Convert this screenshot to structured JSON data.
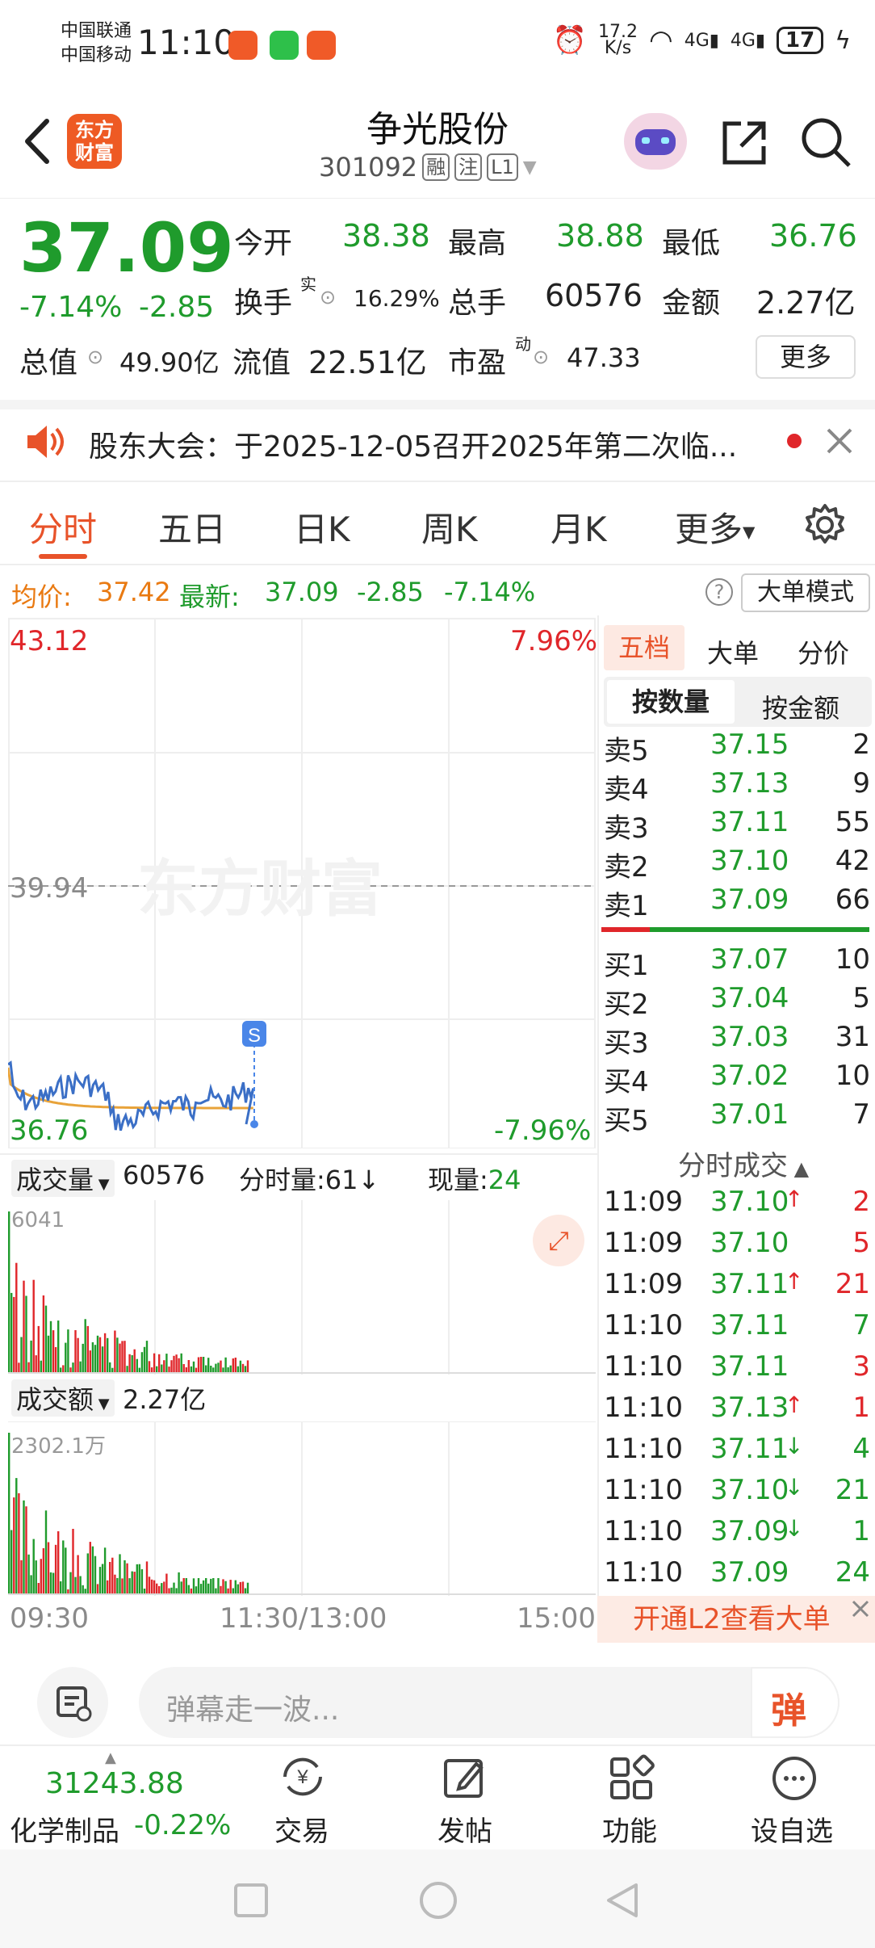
{
  "status": {
    "carrier1": "中国联通",
    "carrier2": "中国移动",
    "time": "11:10",
    "speed_top": "17.2",
    "speed_bot": "K/s",
    "net1": "4G",
    "net2": "4G",
    "battery": "17"
  },
  "header": {
    "logo_line1": "东方",
    "logo_line2": "财富",
    "name": "争光股份",
    "code": "301092",
    "tags": [
      "融",
      "注",
      "L1"
    ]
  },
  "quote": {
    "price": "37.09",
    "change_pct": "-7.14%",
    "change": "-2.85",
    "open_label": "今开",
    "open": "38.38",
    "high_label": "最高",
    "high": "38.88",
    "low_label": "最低",
    "low": "36.76",
    "turnover_label": "换手",
    "turnover_sup": "实",
    "turnover": "16.29%",
    "volume_label": "总手",
    "volume": "60576",
    "amount_label": "金额",
    "amount": "2.27亿",
    "mktcap_label": "总值",
    "mktcap": "49.90亿",
    "float_label": "流值",
    "float": "22.51亿",
    "pe_label": "市盈",
    "pe_sup": "动",
    "pe": "47.33",
    "more": "更多"
  },
  "notice": {
    "text": "股东大会：于2025-12-05召开2025年第二次临..."
  },
  "tabs": [
    "分时",
    "五日",
    "日K",
    "周K",
    "月K",
    "更多"
  ],
  "avg": {
    "avg_label": "均价:",
    "avg": "37.42",
    "latest_label": "最新:",
    "latest": "37.09",
    "chg": "-2.85",
    "pct": "-7.14%",
    "mode_btn": "大单模式"
  },
  "chart": {
    "top_price": "43.12",
    "top_pct": "7.96%",
    "mid_price": "39.94",
    "bot_price": "36.76",
    "bot_pct": "-7.96%",
    "watermark": "东方财富",
    "s_marker": "S",
    "vol_label": "成交量",
    "vol_value": "60576",
    "vol_min_label": "分时量:61",
    "vol_now_label": "现量:",
    "vol_now": "24",
    "vol_max": "6041",
    "amt_label": "成交额",
    "amt_value": "2.27亿",
    "amt_max": "2302.1万",
    "times": [
      "09:30",
      "11:30/13:00",
      "15:00"
    ]
  },
  "orderbook": {
    "tabs": [
      "五档",
      "大单",
      "分价"
    ],
    "subtabs": [
      "按数量",
      "按金额"
    ],
    "asks": [
      {
        "label": "卖5",
        "price": "37.15",
        "qty": "2"
      },
      {
        "label": "卖4",
        "price": "37.13",
        "qty": "9"
      },
      {
        "label": "卖3",
        "price": "37.11",
        "qty": "55"
      },
      {
        "label": "卖2",
        "price": "37.10",
        "qty": "42"
      },
      {
        "label": "卖1",
        "price": "37.09",
        "qty": "66"
      }
    ],
    "bids": [
      {
        "label": "买1",
        "price": "37.07",
        "qty": "10"
      },
      {
        "label": "买2",
        "price": "37.04",
        "qty": "5"
      },
      {
        "label": "买3",
        "price": "37.03",
        "qty": "31"
      },
      {
        "label": "买4",
        "price": "37.02",
        "qty": "10"
      },
      {
        "label": "买5",
        "price": "37.01",
        "qty": "7"
      }
    ],
    "trades_title": "分时成交",
    "trades": [
      {
        "t": "11:09",
        "p": "37.10",
        "d": "up",
        "q": "2",
        "qc": "red"
      },
      {
        "t": "11:09",
        "p": "37.10",
        "d": "",
        "q": "5",
        "qc": "red"
      },
      {
        "t": "11:09",
        "p": "37.11",
        "d": "up",
        "q": "21",
        "qc": "red"
      },
      {
        "t": "11:10",
        "p": "37.11",
        "d": "",
        "q": "7",
        "qc": "green"
      },
      {
        "t": "11:10",
        "p": "37.11",
        "d": "",
        "q": "3",
        "qc": "red"
      },
      {
        "t": "11:10",
        "p": "37.13",
        "d": "up",
        "q": "1",
        "qc": "red"
      },
      {
        "t": "11:10",
        "p": "37.11",
        "d": "down",
        "q": "4",
        "qc": "green"
      },
      {
        "t": "11:10",
        "p": "37.10",
        "d": "down",
        "q": "21",
        "qc": "green"
      },
      {
        "t": "11:10",
        "p": "37.09",
        "d": "down",
        "q": "1",
        "qc": "green"
      },
      {
        "t": "11:10",
        "p": "37.09",
        "d": "",
        "q": "24",
        "qc": "green"
      }
    ],
    "l2_banner": "开通L2查看大单"
  },
  "comment": {
    "placeholder": "弹幕走一波...",
    "send": "弹"
  },
  "bottom": {
    "index_value": "31243.88",
    "index_name": "化学制品",
    "index_pct": "-0.22%",
    "items": [
      "交易",
      "发帖",
      "功能",
      "设自选"
    ]
  }
}
